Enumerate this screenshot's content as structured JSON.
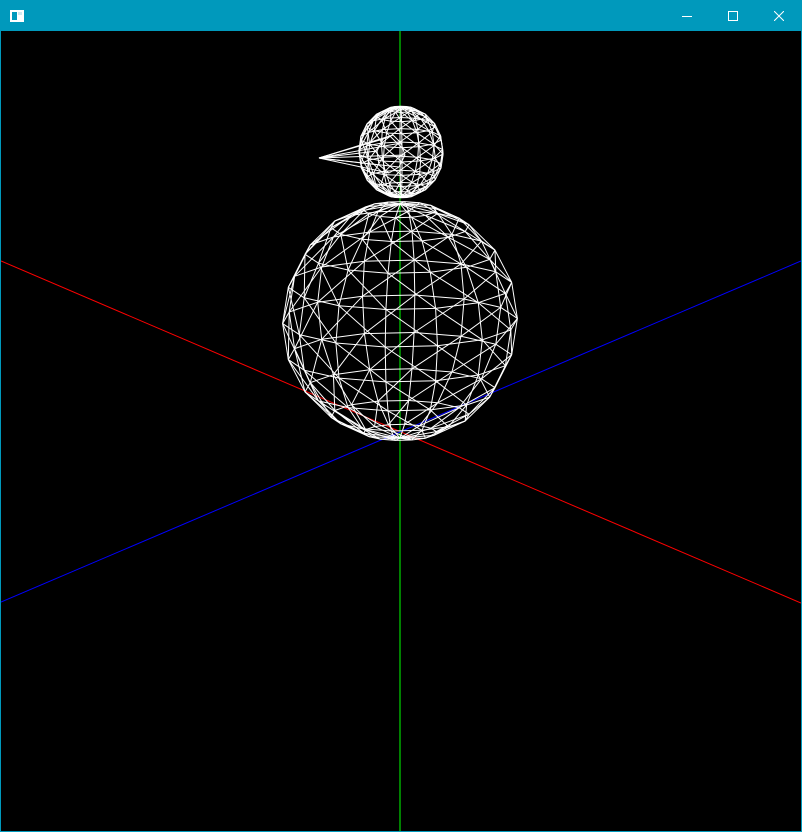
{
  "window": {
    "title": "",
    "titlebar_color": "#0099bc",
    "icons": {
      "app": "app-window-icon",
      "minimize": "minimize-icon",
      "maximize": "maximize-icon",
      "close": "close-icon"
    }
  },
  "scene": {
    "background": "#000000",
    "axes": {
      "x": {
        "color": "#ff0000"
      },
      "y": {
        "color": "#00ff00"
      },
      "z": {
        "color": "#0000ff"
      }
    },
    "wireframe_color": "#ffffff",
    "objects": [
      "body-sphere",
      "head-sphere",
      "beak-cone"
    ]
  }
}
